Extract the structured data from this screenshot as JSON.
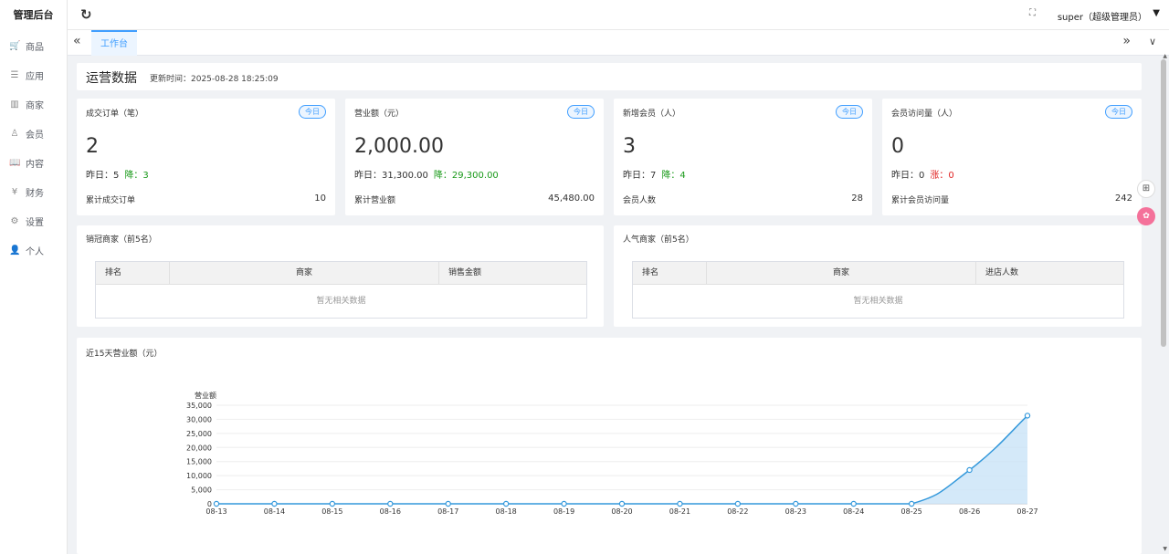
{
  "app": {
    "title": "管理后台"
  },
  "sidebar": {
    "items": [
      {
        "label": "商品",
        "icon": "🛒"
      },
      {
        "label": "应用",
        "icon": "☰"
      },
      {
        "label": "商家",
        "icon": "▥"
      },
      {
        "label": "会员",
        "icon": "♙"
      },
      {
        "label": "内容",
        "icon": "📖"
      },
      {
        "label": "财务",
        "icon": "¥"
      },
      {
        "label": "设置",
        "icon": "⚙"
      },
      {
        "label": "个人",
        "icon": "👤"
      }
    ]
  },
  "header": {
    "refresh_icon": "↻",
    "fullscreen_icon": "⛶",
    "user": "super（超级管理员）",
    "caret": "▼"
  },
  "tabs": {
    "left_btn": "«",
    "active": "工作台",
    "right_btn": "»",
    "down_btn": "∨"
  },
  "overview": {
    "title": "运营数据",
    "updated": "更新时间：2025-08-28 18:25:09"
  },
  "stats": [
    {
      "label": "成交订单（笔）",
      "badge": "今日",
      "value": "2",
      "yd_label": "昨日：5",
      "change": "降：3",
      "dir": "down",
      "total_label": "累计成交订单",
      "total": "10"
    },
    {
      "label": "营业额（元）",
      "badge": "今日",
      "value": "2,000.00",
      "yd_label": "昨日：31,300.00",
      "change": "降：29,300.00",
      "dir": "down",
      "total_label": "累计营业额",
      "total": "45,480.00"
    },
    {
      "label": "新增会员（人）",
      "badge": "今日",
      "value": "3",
      "yd_label": "昨日：7",
      "change": "降：4",
      "dir": "down",
      "total_label": "会员人数",
      "total": "28"
    },
    {
      "label": "会员访问量（人）",
      "badge": "今日",
      "value": "0",
      "yd_label": "昨日：0",
      "change": "涨：0",
      "dir": "up",
      "total_label": "累计会员访问量",
      "total": "242"
    }
  ],
  "rank_sales": {
    "title": "销冠商家（前5名）",
    "columns": [
      "排名",
      "商家",
      "销售金额"
    ],
    "empty": "暂无相关数据"
  },
  "rank_popular": {
    "title": "人气商家（前5名）",
    "columns": [
      "排名",
      "商家",
      "进店人数"
    ],
    "empty": "暂无相关数据"
  },
  "chart_title": "近15天营业额（元）",
  "chart_data": {
    "type": "area",
    "ylabel": "营业额",
    "categories": [
      "08-13",
      "08-14",
      "08-15",
      "08-16",
      "08-17",
      "08-18",
      "08-19",
      "08-20",
      "08-21",
      "08-22",
      "08-23",
      "08-24",
      "08-25",
      "08-26",
      "08-27"
    ],
    "values": [
      0,
      0,
      0,
      0,
      0,
      0,
      0,
      0,
      0,
      0,
      0,
      0,
      0,
      12000,
      31300
    ],
    "ylim": [
      0,
      35000
    ],
    "yticks": [
      "0",
      "5,000",
      "10,000",
      "15,000",
      "20,000",
      "25,000",
      "30,000",
      "35,000"
    ],
    "colors": {
      "line": "#3398db",
      "fill": "#c9e3f7"
    }
  },
  "floats": {
    "a": "⊞",
    "b": "✿"
  }
}
